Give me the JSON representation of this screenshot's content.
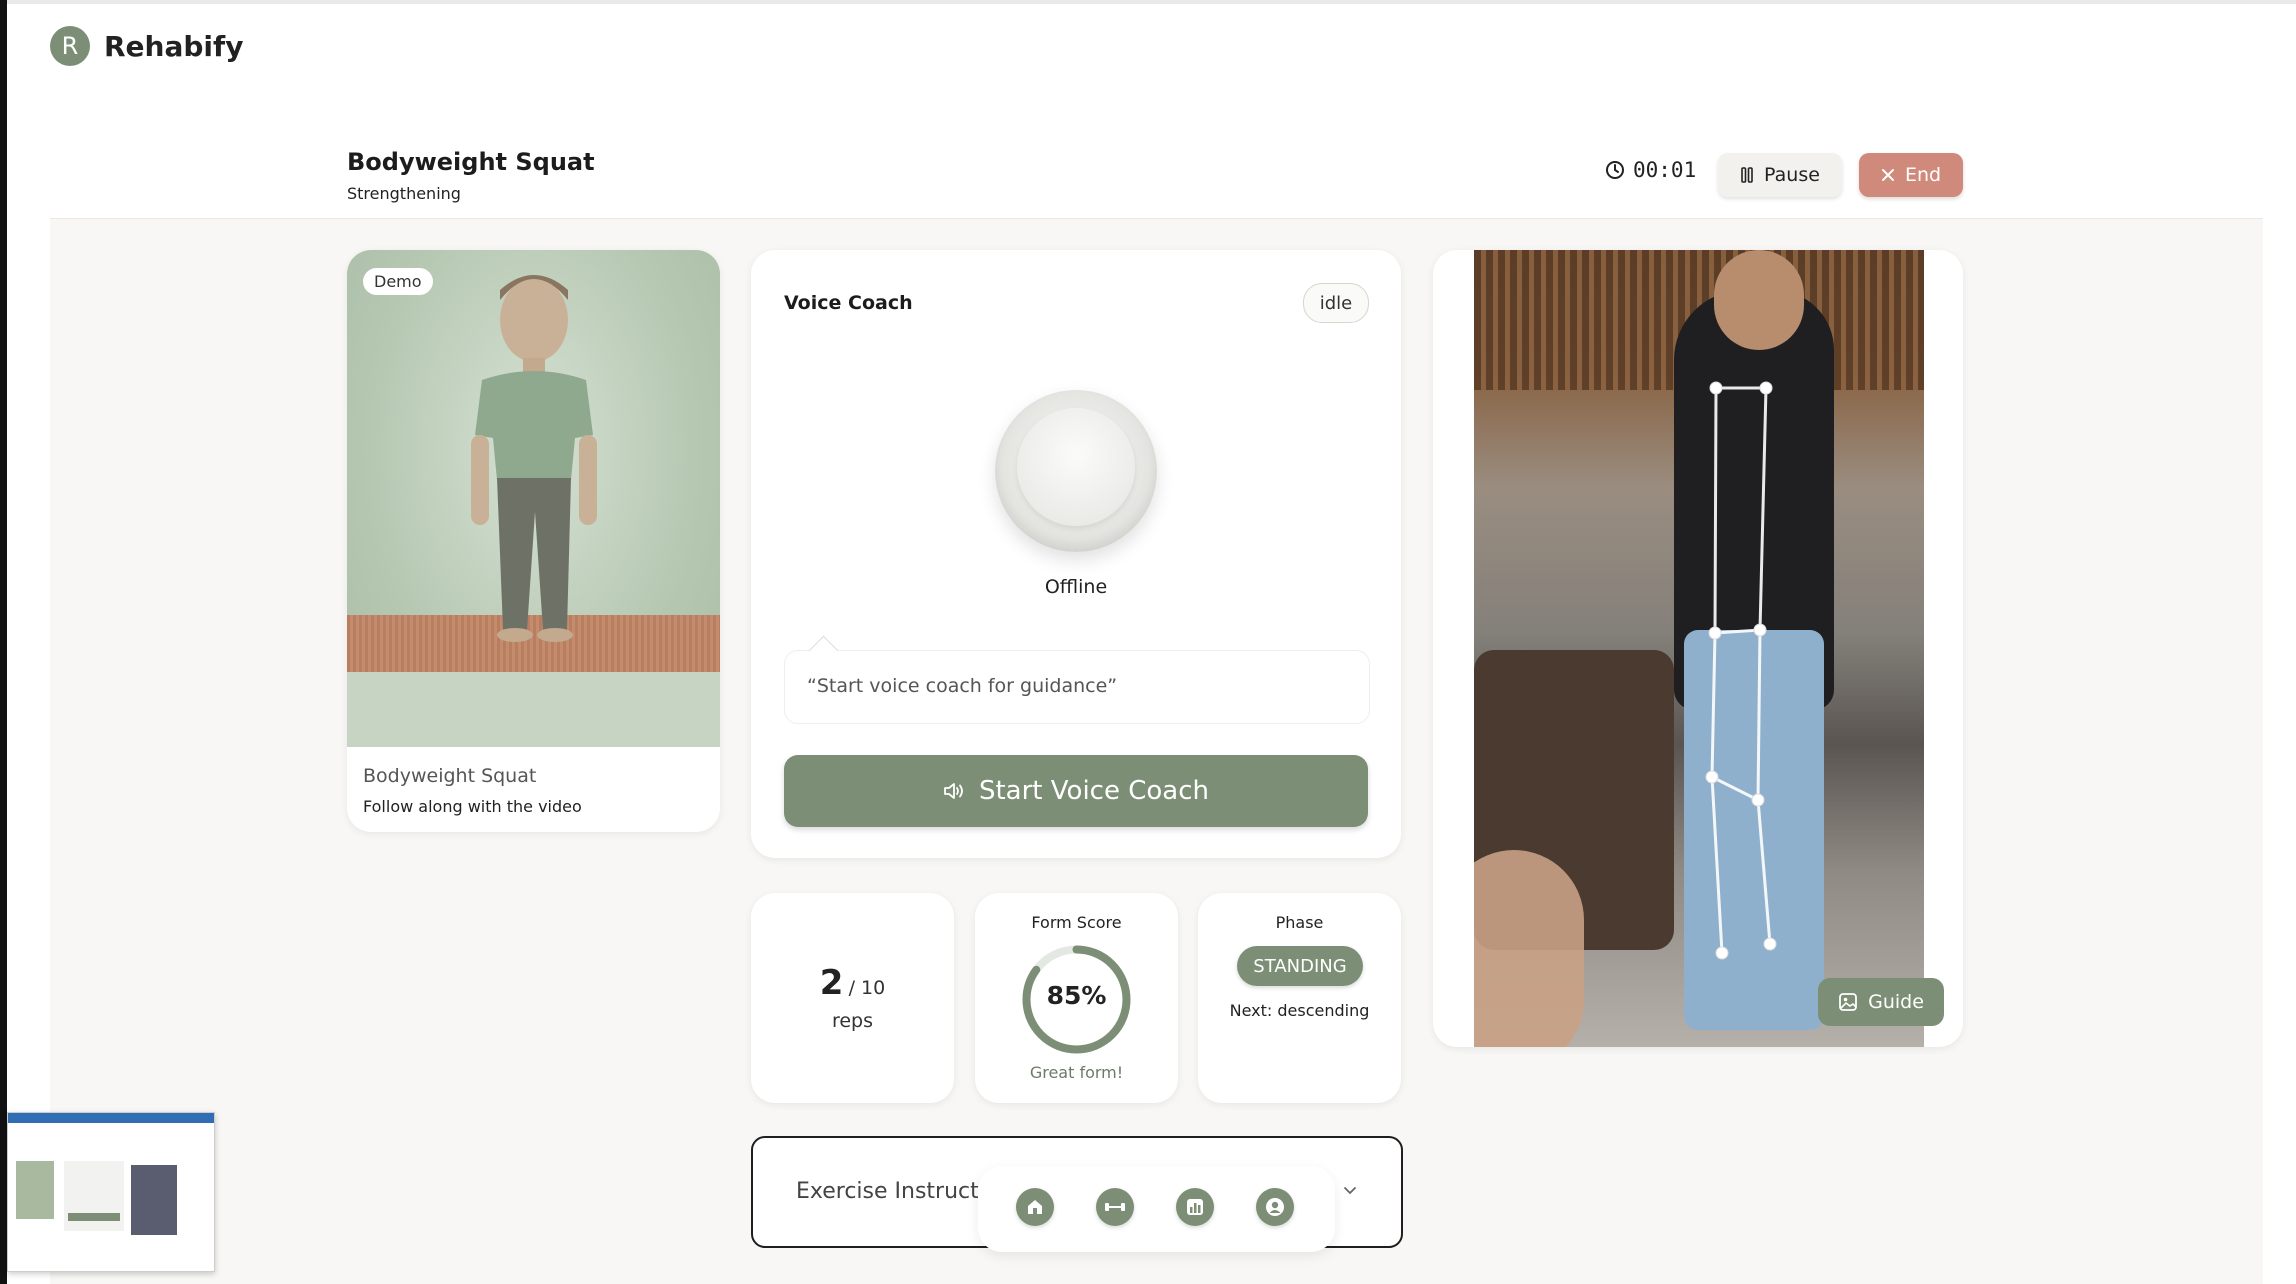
{
  "app": {
    "name": "Rehabify",
    "logo_letter": "R"
  },
  "session": {
    "title": "Bodyweight Squat",
    "subtitle": "Strengthening",
    "timer": "00:01",
    "pause_label": "Pause",
    "end_label": "End"
  },
  "demo": {
    "badge": "Demo",
    "name": "Bodyweight Squat",
    "caption": "Follow along with the video"
  },
  "coach": {
    "title": "Voice Coach",
    "status": "idle",
    "orb_state": "Offline",
    "message": "“Start voice coach for guidance”",
    "start_label": "Start Voice Coach"
  },
  "stats": {
    "reps": {
      "count": "2",
      "total": "/ 10",
      "label": "reps"
    },
    "form": {
      "label": "Form Score",
      "value": "85%",
      "fraction": 0.85,
      "caption": "Great form!"
    },
    "phase": {
      "label": "Phase",
      "value": "STANDING",
      "next": "Next: descending"
    }
  },
  "camera": {
    "guide_label": "Guide"
  },
  "instructions": {
    "label": "Exercise Instructions"
  },
  "nav": {
    "items": [
      {
        "icon": "home-icon"
      },
      {
        "icon": "dumbbell-icon"
      },
      {
        "icon": "chart-icon"
      },
      {
        "icon": "profile-icon"
      }
    ]
  },
  "colors": {
    "accent": "#7c8f76",
    "danger": "#cf8a7b",
    "background": "#f8f7f5"
  }
}
